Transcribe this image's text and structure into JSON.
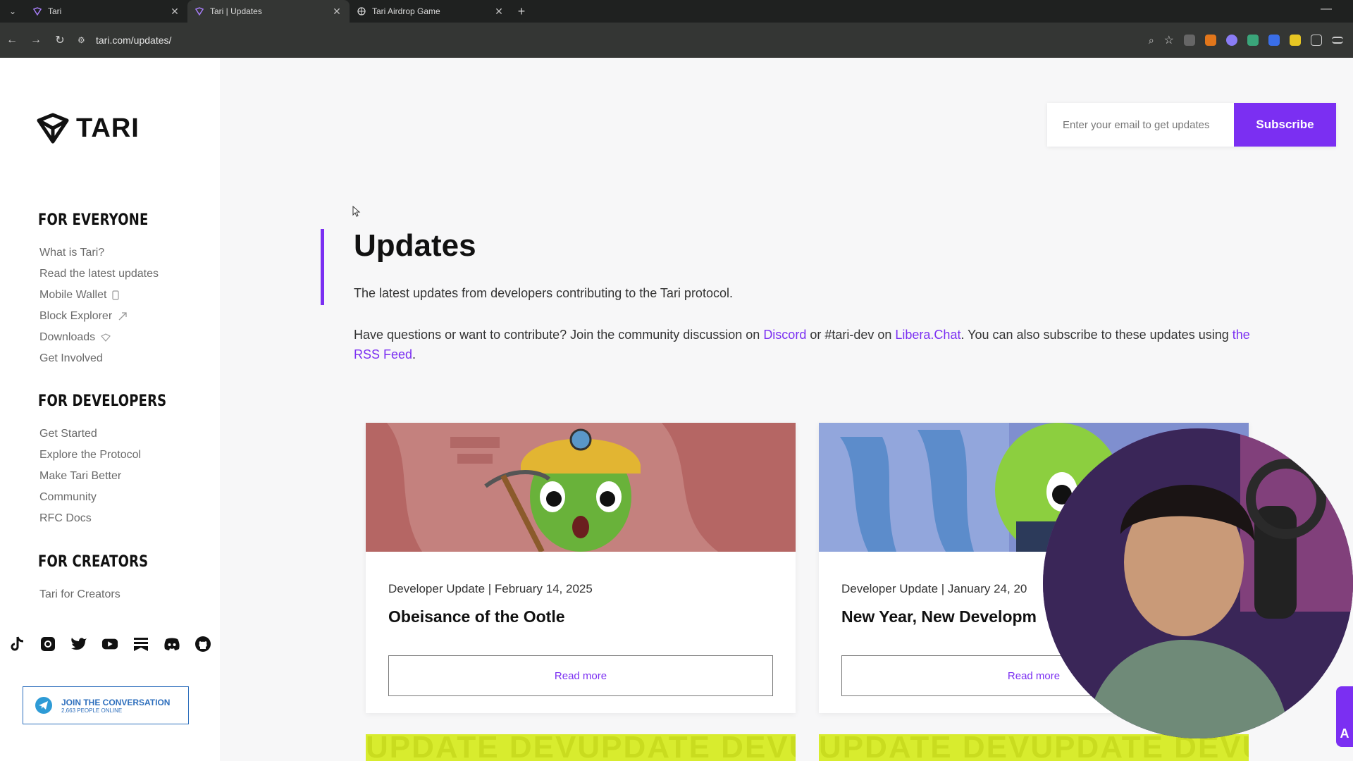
{
  "browser": {
    "tabs": [
      {
        "label": "Tari",
        "active": false
      },
      {
        "label": "Tari | Updates",
        "active": true
      },
      {
        "label": "Tari Airdrop Game",
        "active": false
      }
    ],
    "url": "tari.com/updates/"
  },
  "sidebar": {
    "logo_text": "TARI",
    "sections": [
      {
        "title": "FOR EVERYONE",
        "items": [
          "What is Tari?",
          "Read the latest updates",
          "Mobile Wallet",
          "Block Explorer",
          "Downloads",
          "Get Involved"
        ]
      },
      {
        "title": "FOR DEVELOPERS",
        "items": [
          "Get Started",
          "Explore the Protocol",
          "Make Tari Better",
          "Community",
          "RFC Docs"
        ]
      },
      {
        "title": "FOR CREATORS",
        "items": [
          "Tari for Creators"
        ]
      }
    ],
    "join": {
      "title": "JOIN THE CONVERSATION",
      "subtitle": "2,663 PEOPLE ONLINE"
    }
  },
  "subscribe": {
    "placeholder": "Enter your email to get updates",
    "button": "Subscribe"
  },
  "main": {
    "title": "Updates",
    "description": "The latest updates from developers contributing to the Tari protocol.",
    "community_prefix": "Have questions or want to contribute? Join the community discussion on ",
    "discord": "Discord",
    "community_mid": " or #tari-dev on ",
    "libera": "Libera.Chat",
    "community_suffix": ". You can also subscribe to these updates using ",
    "rss": "the RSS Feed",
    "period": "."
  },
  "cards": [
    {
      "meta": "Developer Update | February 14, 2025",
      "title": "Obeisance of the Ootle",
      "button": "Read more"
    },
    {
      "meta": "Developer Update | January 24, 20",
      "title": "New Year, New Developm",
      "button": "Read more"
    }
  ],
  "banner_text": "UPDATE DEVUPDATE DEVUPDATE",
  "side_tab": "A",
  "colors": {
    "accent": "#7b2ff2",
    "banner": "#d8ec2e"
  }
}
